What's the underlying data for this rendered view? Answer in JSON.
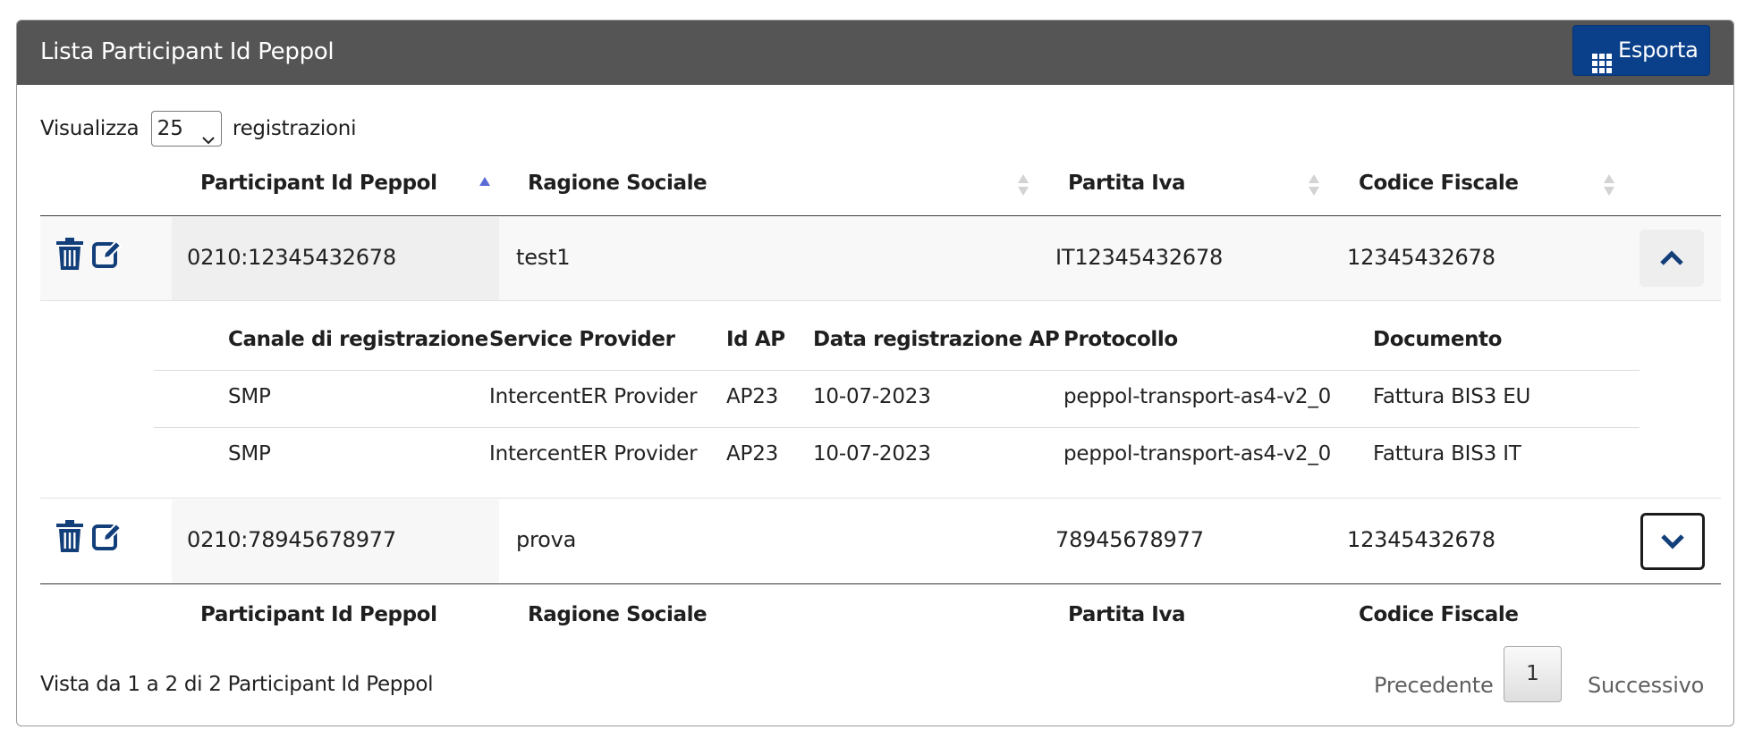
{
  "panel": {
    "title": "Lista Participant Id Peppol",
    "export_label": "Esporta"
  },
  "length": {
    "prefix": "Visualizza",
    "value": "25",
    "suffix": "registrazioni"
  },
  "columns": [
    "Participant Id Peppol",
    "Ragione Sociale",
    "Partita Iva",
    "Codice Fiscale"
  ],
  "sort": {
    "column": "Participant Id Peppol",
    "direction": "ascending"
  },
  "rows": [
    {
      "participant_id": "0210:12345432678",
      "ragione_sociale": "test1",
      "partita_iva": "IT12345432678",
      "codice_fiscale": "12345432678",
      "expanded": true
    },
    {
      "participant_id": "0210:78945678977",
      "ragione_sociale": "prova",
      "partita_iva": "78945678977",
      "codice_fiscale": "12345432678",
      "expanded": false
    }
  ],
  "detail": {
    "columns": [
      "Canale di registrazione",
      "Service Provider",
      "Id AP",
      "Data registrazione AP",
      "Protocollo",
      "Documento"
    ],
    "rows": [
      [
        "SMP",
        "IntercentER Provider",
        "AP23",
        "10-07-2023",
        "peppol-transport-as4-v2_0",
        "Fattura BIS3 EU"
      ],
      [
        "SMP",
        "IntercentER Provider",
        "AP23",
        "10-07-2023",
        "peppol-transport-as4-v2_0",
        "Fattura BIS3 IT"
      ]
    ]
  },
  "footer": {
    "info": "Vista da 1 a 2 di 2 Participant Id Peppol",
    "prev": "Precedente",
    "current_page": "1",
    "next": "Successivo"
  },
  "colors": {
    "header_bg": "#555555",
    "primary": "#0a3f8a",
    "sort_active": "#5b6bd6",
    "icon": "#123f7a"
  },
  "icons": {
    "export": "grid-icon",
    "delete": "trash-icon",
    "edit": "edit-icon",
    "collapse": "chevron-up-icon",
    "expand": "chevron-down-icon"
  }
}
